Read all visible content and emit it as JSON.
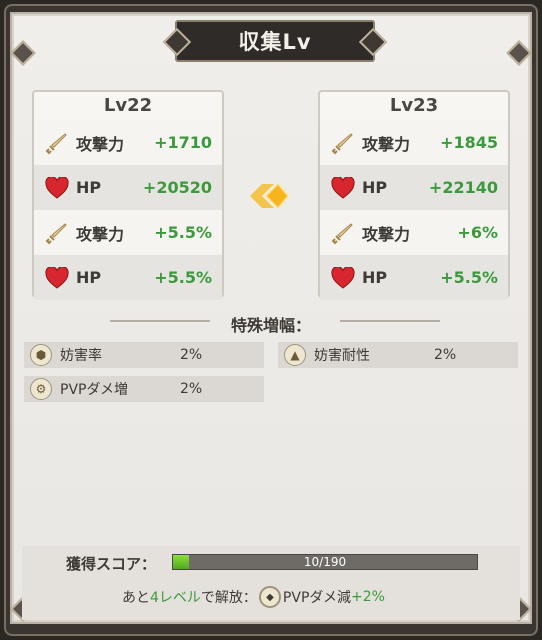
{
  "title": "収集Lv",
  "current": {
    "level": "Lv22",
    "stats": [
      {
        "icon": "sword-icon",
        "label": "攻撃力",
        "value": "+1710"
      },
      {
        "icon": "heart-icon",
        "label": "HP",
        "value": "+20520"
      },
      {
        "icon": "sword-icon",
        "label": "攻撃力",
        "value": "+5.5%"
      },
      {
        "icon": "heart-icon",
        "label": "HP",
        "value": "+5.5%"
      }
    ]
  },
  "next": {
    "level": "Lv23",
    "stats": [
      {
        "icon": "sword-icon",
        "label": "攻撃力",
        "value": "+1845"
      },
      {
        "icon": "heart-icon",
        "label": "HP",
        "value": "+22140"
      },
      {
        "icon": "sword-icon",
        "label": "攻撃力",
        "value": "+6%"
      },
      {
        "icon": "heart-icon",
        "label": "HP",
        "value": "+5.5%"
      }
    ]
  },
  "special": {
    "heading": "特殊増幅：",
    "items": [
      {
        "icon": "hexagon-dots-icon",
        "label": "妨害率",
        "value": "2%"
      },
      {
        "icon": "shield-up-icon",
        "label": "妨害耐性",
        "value": "2%"
      },
      {
        "icon": "gear-icon",
        "label": "PVPダメ増",
        "value": "2%"
      }
    ]
  },
  "score": {
    "label": "獲得スコア：",
    "current": 10,
    "max": 190,
    "text": "10/190",
    "progress_fraction": 0.0526
  },
  "unlock": {
    "prefix": "あと",
    "count": "4レベル",
    "middle": "で解放：",
    "reward": "PVPダメ減",
    "bonus": "+2%"
  },
  "colors": {
    "value_green": "#3b9a3b",
    "bar_fill": "#6cc22c",
    "arrow": "#f6b51c"
  }
}
